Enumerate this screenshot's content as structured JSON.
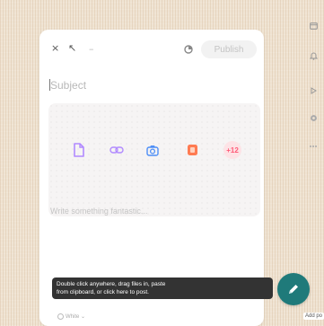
{
  "toolbar": {
    "close_label": "×",
    "expand_label": "↖",
    "minimize_label": "–",
    "publish_label": "Publish"
  },
  "composer": {
    "subject_placeholder": "Subject",
    "body_placeholder": "Write something fantastic...",
    "media_icons": [
      "file-icon",
      "link-icon",
      "camera-icon",
      "gift-icon"
    ],
    "extra_count": "+12"
  },
  "footer": {
    "visibility_label": "White",
    "tooltip_line1": "Double click anywhere, drag files in, paste",
    "tooltip_line2": "from clipboard, or click here to post.",
    "fab_label": "Add po"
  },
  "rail_icons": [
    "window-icon",
    "bell-icon",
    "play-icon",
    "gear-icon",
    "more-icon"
  ],
  "colors": {
    "accent": "#1f7a7a",
    "media_icon_purple": "#b18aff",
    "camera_icon_blue": "#4f8ff7",
    "gift_icon_orange": "#ff7b52",
    "badge_pink": "#ff5a78"
  }
}
